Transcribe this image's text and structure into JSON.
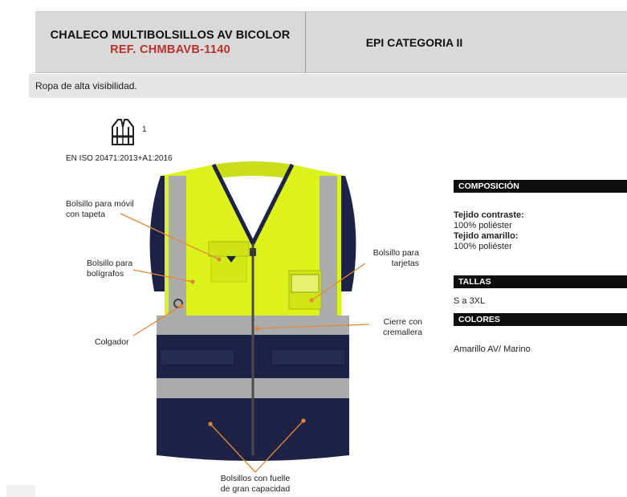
{
  "header": {
    "product_name": "CHALECO MULTIBOLSILLOS AV BICOLOR",
    "reference": "REF. CHMBAVB-1140",
    "category": "EPI CATEGORIA II"
  },
  "subtitle": "Ropa de alta visibilidad.",
  "certification": {
    "icon": "high-visibility-vest-icon",
    "class_number": "1",
    "standard": "EN ISO 20471:2013+A1:2016"
  },
  "callouts": {
    "phone_pocket": [
      "Bolsillo para móvil",
      "con tapeta"
    ],
    "pen_pocket": [
      "Bolsillo para",
      "bolígrafos"
    ],
    "hanger": "Colgador",
    "card_pocket": [
      "Bolsillo para",
      "tarjetas"
    ],
    "zipper": [
      "Cierre con",
      "cremallera"
    ],
    "bellows_pockets": [
      "Bolsillos con fuelle",
      "de gran capacidad"
    ]
  },
  "composition": {
    "title": "COMPOSICIÓN",
    "contrast_label": "Tejido contraste:",
    "contrast_value": "100% poliéster",
    "yellow_label": "Tejido amarillo:",
    "yellow_value": "100% poliéster"
  },
  "sizes": {
    "title": "TALLAS",
    "value": "S a 3XL"
  },
  "colors": {
    "title": "COLORES",
    "value": "Amarillo AV/ Marino"
  },
  "palette": {
    "header_bg": "#d9d9d9",
    "reference_red": "#b7312c",
    "hi_vis_yellow": "#dcf21a",
    "navy": "#1e2244",
    "reflective_grey": "#a9abad",
    "leader_orange": "#e0873a"
  }
}
